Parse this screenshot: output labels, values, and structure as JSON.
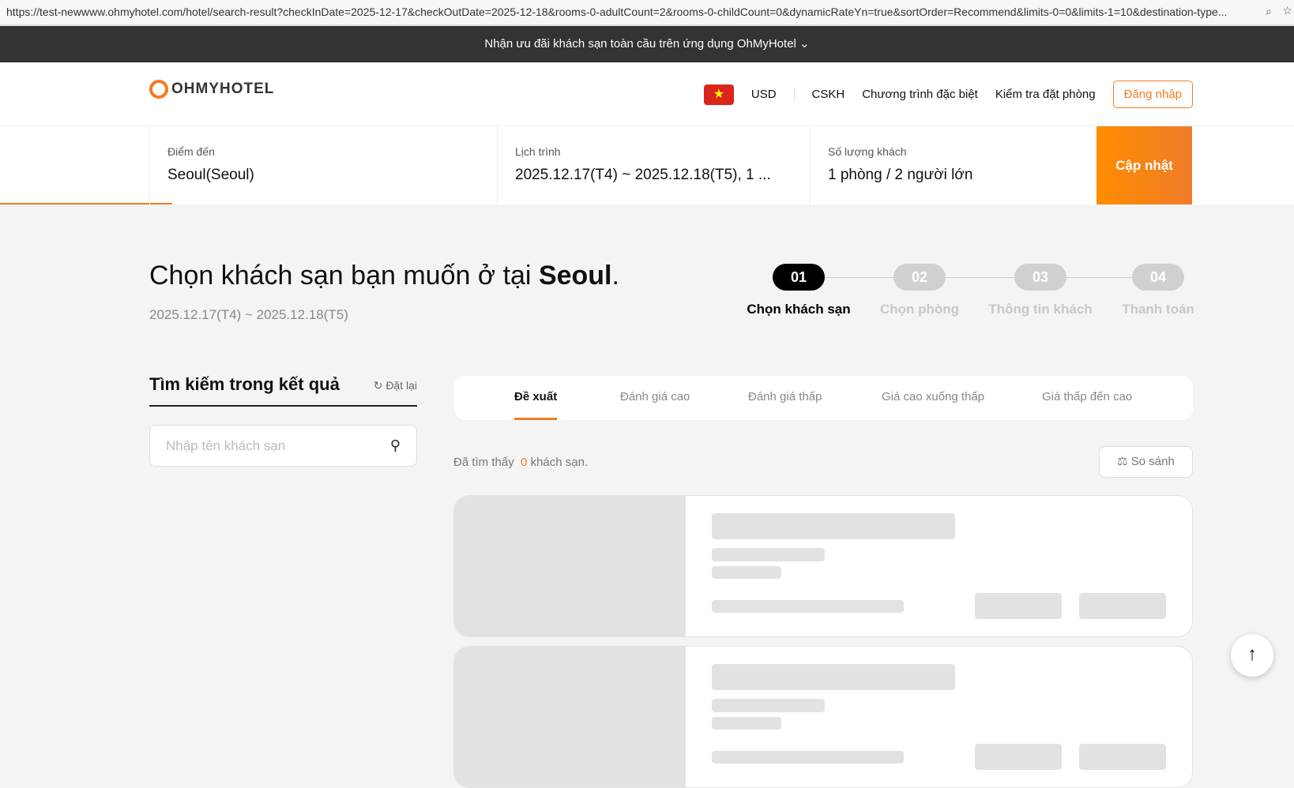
{
  "browser": {
    "url": "https://test-newwww.ohmyhotel.com/hotel/search-result?checkInDate=2025-12-17&checkOutDate=2025-12-18&rooms-0-adultCount=2&rooms-0-childCount=0&dynamicRateYn=true&sortOrder=Recommend&limits-0=0&limits-1=10&destination-type..."
  },
  "banner": {
    "text": "Nhận ưu đãi khách sạn toàn cầu trên ứng dụng OhMyHotel",
    "chevron": "⌄"
  },
  "header": {
    "logo": "OHMYHOTEL",
    "flag": "★",
    "currency": "USD",
    "links": [
      "CSKH",
      "Chương trình đặc biệt",
      "Kiểm tra đặt phòng"
    ],
    "login": "Đăng nhập"
  },
  "search": {
    "destination_label": "Điểm đến",
    "destination": "Seoul(Seoul)",
    "schedule_label": "Lịch trình",
    "schedule": "2025.12.17(T4) ~ 2025.12.18(T5), 1 ...",
    "guests_label": "Số lượng khách",
    "guests": "1 phòng / 2 người lớn",
    "update": "Cập nhật"
  },
  "title": {
    "prefix": "Chọn khách sạn bạn muốn ở tại ",
    "city": "Seoul",
    "suffix": ".",
    "dates": "2025.12.17(T4) ~ 2025.12.18(T5)"
  },
  "steps": [
    {
      "num": "01",
      "label": "Chọn khách sạn"
    },
    {
      "num": "02",
      "label": "Chọn phòng"
    },
    {
      "num": "03",
      "label": "Thông tin khách"
    },
    {
      "num": "04",
      "label": "Thanh toán"
    }
  ],
  "sidebar": {
    "title": "Tìm kiếm trong kết quả",
    "reset": "Đặt lại",
    "placeholder": "Nhập tên khách sạn"
  },
  "sort_tabs": [
    "Đề xuất",
    "Đánh giá cao",
    "Đánh giá thấp",
    "Giá cao xuống thấp",
    "Giá thấp đến cao"
  ],
  "results": {
    "prefix": "Đã tìm thấy",
    "count": "0",
    "suffix": "khách sạn.",
    "compare": "So sánh"
  },
  "colors": {
    "accent": "#f47a20",
    "banner": "#333333"
  }
}
